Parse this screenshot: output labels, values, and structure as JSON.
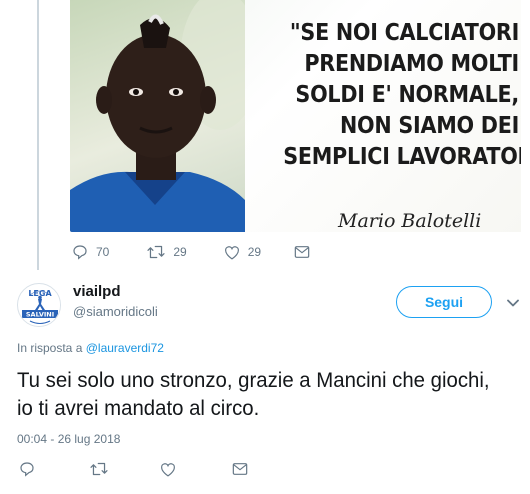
{
  "quoted_media": {
    "quote_lines": [
      "\"SE NOI CALCIATORI",
      "PRENDIAMO MOLTI",
      "SOLDI E' NORMALE,",
      "NON SIAMO DEI",
      "SEMPLICI LAVORATORI\""
    ],
    "signature": "Mario Balotelli"
  },
  "parent_actions": {
    "reply_count": "70",
    "retweet_count": "29",
    "like_count": "29"
  },
  "tweet": {
    "display_name": "viailpd",
    "screen_name": "@siamoridicoli",
    "follow_label": "Segui",
    "reply_prefix": "In risposta a",
    "reply_handle": "@lauraverdi72",
    "text": "Tu sei solo uno stronzo, grazie a Mancini che giochi, io ti avrei mandato al circo.",
    "timestamp": "00:04 - 26 lug 2018"
  },
  "avatar_badge": {
    "top_text": "LEGA",
    "band_text": "SALVINI"
  },
  "colors": {
    "accent": "#1da1f2",
    "link": "#1b95e0",
    "muted": "#657786",
    "divider": "#ccd6dd"
  },
  "icons": [
    "reply-icon",
    "retweet-icon",
    "like-icon",
    "message-icon",
    "chevron-down-icon"
  ]
}
